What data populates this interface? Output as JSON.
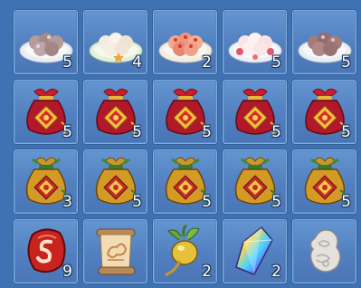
{
  "inventory": {
    "rows": [
      [
        {
          "icon": "dumplings-plate-icon",
          "count": "5"
        },
        {
          "icon": "dumplings-plate-icon",
          "count": "4"
        },
        {
          "icon": "dumplings-plate-icon",
          "count": "2"
        },
        {
          "icon": "dumplings-plate-icon",
          "count": "5"
        },
        {
          "icon": "dumplings-plate-icon",
          "count": "5"
        }
      ],
      [
        {
          "icon": "red-lucky-bag-icon",
          "count": "5"
        },
        {
          "icon": "red-lucky-bag-icon",
          "count": "5"
        },
        {
          "icon": "red-lucky-bag-icon",
          "count": "5"
        },
        {
          "icon": "red-lucky-bag-icon",
          "count": "5"
        },
        {
          "icon": "red-lucky-bag-icon",
          "count": "5"
        }
      ],
      [
        {
          "icon": "gold-lucky-bag-icon",
          "count": "3"
        },
        {
          "icon": "gold-lucky-bag-icon",
          "count": "5"
        },
        {
          "icon": "gold-lucky-bag-icon",
          "count": "5"
        },
        {
          "icon": "gold-lucky-bag-icon",
          "count": "5"
        },
        {
          "icon": "gold-lucky-bag-icon",
          "count": "5"
        }
      ],
      [
        {
          "icon": "red-rune-stone-icon",
          "count": "9"
        },
        {
          "icon": "scroll-icon",
          "count": ""
        },
        {
          "icon": "golden-turnip-icon",
          "count": "2"
        },
        {
          "icon": "rainbow-crystal-icon",
          "count": "2"
        },
        {
          "icon": "jade-carving-icon",
          "count": ""
        }
      ]
    ]
  },
  "colors": {
    "background": "#3f72b3",
    "slot": "#5a88c7",
    "count_text": "#ffffff"
  }
}
